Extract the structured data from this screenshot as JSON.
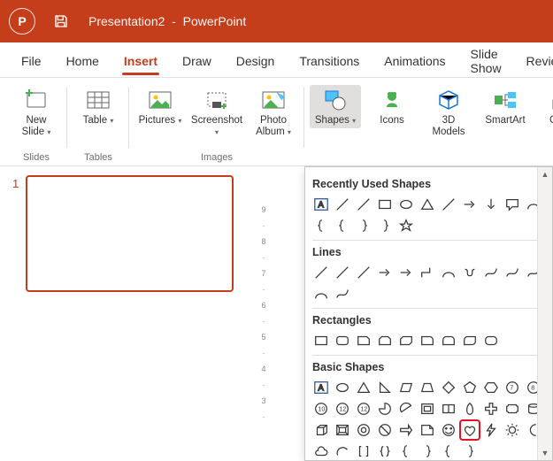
{
  "app": {
    "doc_name": "Presentation2",
    "app_name": "PowerPoint"
  },
  "tabs": [
    "File",
    "Home",
    "Insert",
    "Draw",
    "Design",
    "Transitions",
    "Animations",
    "Slide Show",
    "Revie"
  ],
  "active_tab": 2,
  "ribbon": {
    "groups": [
      {
        "label": "Slides",
        "items": [
          {
            "label": "New\nSlide",
            "drop": true
          }
        ]
      },
      {
        "label": "Tables",
        "items": [
          {
            "label": "Table",
            "drop": true
          }
        ]
      },
      {
        "label": "Images",
        "items": [
          {
            "label": "Pictures",
            "drop": true
          },
          {
            "label": "Screenshot",
            "drop": true
          },
          {
            "label": "Photo\nAlbum",
            "drop": true
          }
        ]
      },
      {
        "label": "",
        "items": [
          {
            "label": "Shapes",
            "drop": true,
            "active": true
          },
          {
            "label": "Icons",
            "drop": false
          },
          {
            "label": "3D\nModels",
            "drop": false
          },
          {
            "label": "SmartArt",
            "drop": false
          },
          {
            "label": "Chart",
            "drop": false
          }
        ]
      }
    ]
  },
  "thumbnails": [
    {
      "num": "1"
    }
  ],
  "ruler_marks": [
    "9",
    "",
    "8",
    "",
    "7",
    "",
    "6",
    "",
    "5",
    "",
    "4",
    "",
    "3",
    ""
  ],
  "shapes_panel": {
    "sections": [
      {
        "title": "Recently Used Shapes",
        "shapes": [
          "textbox",
          "line",
          "line",
          "rect",
          "oval",
          "triangle",
          "line",
          "arrow-r",
          "arrow-d",
          "callout",
          "curve",
          "brace-l",
          "brace-l",
          "brace-r",
          "brace-r",
          "star"
        ]
      },
      {
        "title": "Lines",
        "shapes": [
          "line",
          "line",
          "line",
          "arrow-r",
          "arrow-r",
          "elbow",
          "curve",
          "s",
          "free",
          "free",
          "free",
          "curve",
          "free"
        ]
      },
      {
        "title": "Rectangles",
        "shapes": [
          "rect",
          "roundrect",
          "snip1",
          "snip2",
          "snipdiag",
          "round1",
          "round2",
          "rounddiag",
          "roundsame"
        ]
      },
      {
        "title": "Basic Shapes",
        "shapes": [
          "textbox",
          "oval",
          "triangle",
          "rtri",
          "para",
          "trap",
          "diamond",
          "pent",
          "hex",
          "hept",
          "oct",
          "dec",
          "dodec",
          "dodec",
          "pie",
          "chord",
          "frame",
          "half",
          "tear",
          "cross",
          "plaque",
          "can",
          "cube",
          "bevel",
          "donut",
          "noentry",
          "block",
          "fold",
          "smiley",
          "heart",
          "bolt",
          "sun",
          "moon",
          "cloud",
          "arc",
          "dbracket",
          "dbrace",
          "brace-l",
          "brace-r",
          "brace-l",
          "brace-r"
        ],
        "highlighted": 29
      }
    ]
  }
}
